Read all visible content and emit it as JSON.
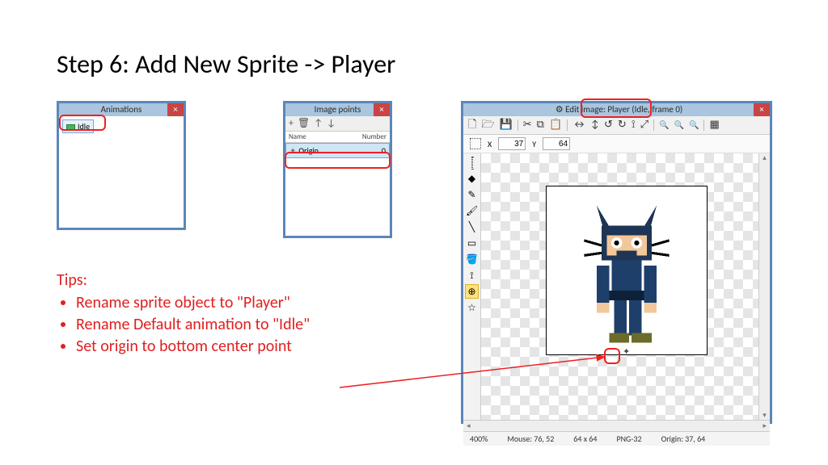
{
  "page_title": "Step 6: Add New Sprite -> Player",
  "animations_panel": {
    "title": "Animations",
    "close": "×",
    "item": "Idle"
  },
  "points_panel": {
    "title": "Image points",
    "close": "×",
    "toolbar": {
      "add": "+",
      "delete": "🗑",
      "up": "↑",
      "down": "↓"
    },
    "header_name": "Name",
    "header_number": "Number",
    "row_name": "Origin",
    "row_number": "0"
  },
  "edit_panel": {
    "title": "Edit image: Player (Idle, frame 0)",
    "close": "×",
    "toolbar": {
      "new": "🗋",
      "open": "🗁",
      "save": "💾",
      "cut": "✂",
      "copy": "⧉",
      "paste": "📋",
      "flip_h": "↔",
      "flip_v": "↕",
      "rot_ccw": "↺",
      "rot_cw": "↻",
      "crop": "⟟",
      "resize": "⤢",
      "zoom_out": "🔍-",
      "zoom_fit": "🔍",
      "zoom_in": "🔍+",
      "grid": "▦"
    },
    "sub": {
      "x_label": "X",
      "x_val": "37",
      "y_label": "Y",
      "y_val": "64"
    },
    "tools": {
      "select": "⬚",
      "eraser": "◆",
      "pencil": "✎",
      "brush": "🖌",
      "line": "╲",
      "rect": "▭",
      "fill": "🪣",
      "picker": "⟟",
      "origin": "⊕",
      "points": "☆"
    },
    "status": {
      "zoom": "400%",
      "mouse": "Mouse: 76, 52",
      "size": "64 x 64",
      "format": "PNG-32",
      "origin": "Origin: 37, 64"
    }
  },
  "tips": {
    "title": "Tips:",
    "items": [
      "Rename sprite object to \"Player\"",
      "Rename Default animation to \"Idle\"",
      "Set origin to bottom center point"
    ]
  }
}
